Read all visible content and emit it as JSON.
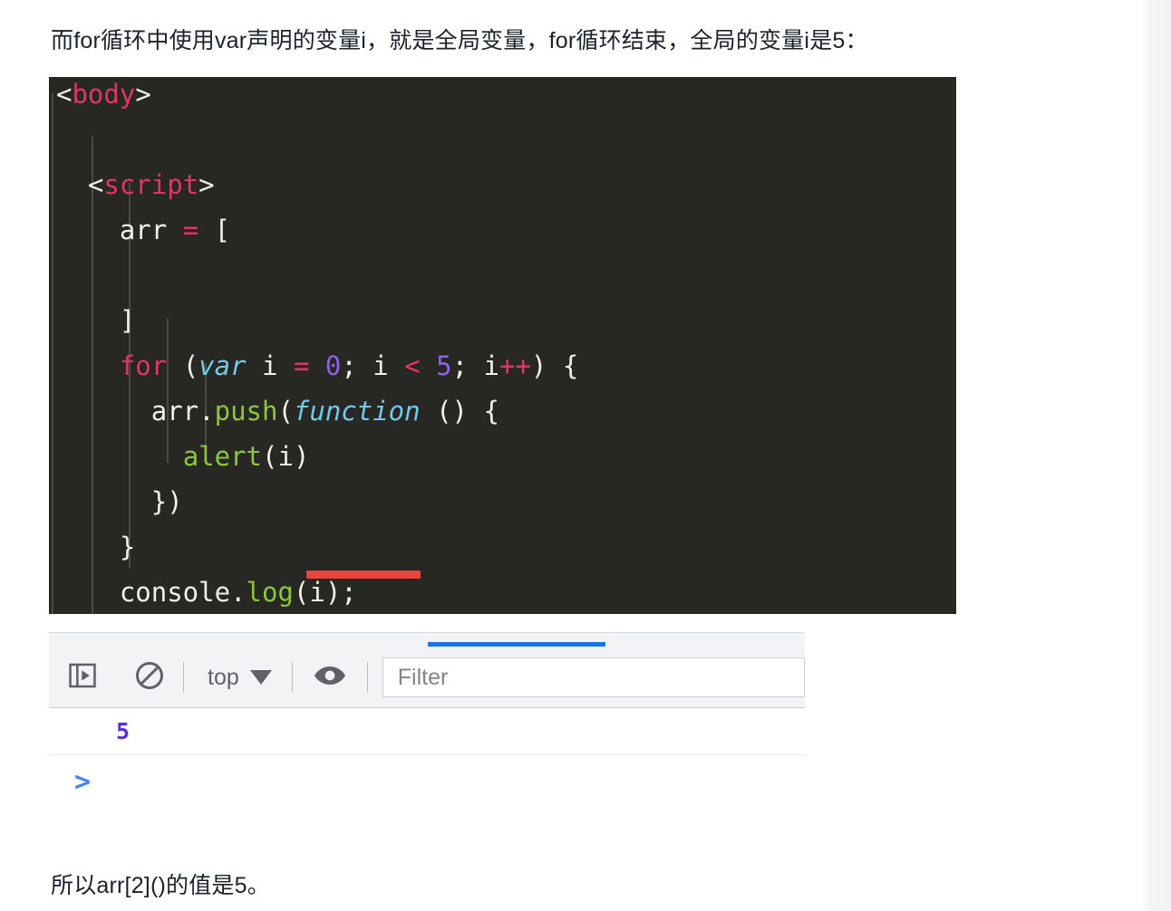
{
  "page": {
    "intro_text": "而for循环中使用var声明的变量i，就是全局变量，for循环结束，全局的变量i是5：",
    "outro_text": "所以arr[2]()的值是5。"
  },
  "code_block": {
    "background": "#272723",
    "language": "html",
    "lines": [
      {
        "indent": 0,
        "tokens": [
          {
            "t": "<",
            "c": "punct"
          },
          {
            "t": "body",
            "c": "tag"
          },
          {
            "t": ">",
            "c": "punct"
          }
        ]
      },
      {
        "indent": 0,
        "tokens": []
      },
      {
        "indent": 0,
        "tokens": [
          {
            "t": "  <",
            "c": "punct"
          },
          {
            "t": "script",
            "c": "tag"
          },
          {
            "t": ">",
            "c": "punct"
          }
        ]
      },
      {
        "indent": 0,
        "tokens": [
          {
            "t": "    arr ",
            "c": "plain"
          },
          {
            "t": "=",
            "c": "op"
          },
          {
            "t": " [",
            "c": "punct"
          }
        ]
      },
      {
        "indent": 0,
        "tokens": []
      },
      {
        "indent": 0,
        "tokens": [
          {
            "t": "    ]",
            "c": "punct"
          }
        ]
      },
      {
        "indent": 0,
        "tokens": [
          {
            "t": "    ",
            "c": "plain"
          },
          {
            "t": "for",
            "c": "keyword"
          },
          {
            "t": " (",
            "c": "punct"
          },
          {
            "t": "var",
            "c": "italic"
          },
          {
            "t": " i ",
            "c": "plain"
          },
          {
            "t": "=",
            "c": "op"
          },
          {
            "t": " ",
            "c": "plain"
          },
          {
            "t": "0",
            "c": "num"
          },
          {
            "t": "; i ",
            "c": "plain"
          },
          {
            "t": "<",
            "c": "op"
          },
          {
            "t": " ",
            "c": "plain"
          },
          {
            "t": "5",
            "c": "num"
          },
          {
            "t": "; i",
            "c": "plain"
          },
          {
            "t": "++",
            "c": "op"
          },
          {
            "t": ") {",
            "c": "punct"
          }
        ]
      },
      {
        "indent": 0,
        "tokens": [
          {
            "t": "      arr.",
            "c": "plain"
          },
          {
            "t": "push",
            "c": "method"
          },
          {
            "t": "(",
            "c": "punct"
          },
          {
            "t": "function",
            "c": "italic"
          },
          {
            "t": " () {",
            "c": "punct"
          }
        ]
      },
      {
        "indent": 0,
        "tokens": [
          {
            "t": "        ",
            "c": "plain"
          },
          {
            "t": "alert",
            "c": "func"
          },
          {
            "t": "(",
            "c": "punct"
          },
          {
            "t": "i",
            "c": "plain"
          },
          {
            "t": ")",
            "c": "punct"
          }
        ]
      },
      {
        "indent": 0,
        "tokens": [
          {
            "t": "      })",
            "c": "punct"
          }
        ]
      },
      {
        "indent": 0,
        "tokens": [
          {
            "t": "    }",
            "c": "punct"
          }
        ]
      },
      {
        "indent": 0,
        "tokens": [
          {
            "t": "    console.",
            "c": "plain"
          },
          {
            "t": "log",
            "c": "method"
          },
          {
            "t": "(",
            "c": "punct"
          },
          {
            "t": "i",
            "c": "plain"
          },
          {
            "t": ");",
            "c": "punct"
          }
        ]
      }
    ],
    "error_underline": {
      "label": "red-error-underline"
    }
  },
  "devtools": {
    "panel_name": "console-panel",
    "toolbar": {
      "sidebar_toggle_icon": "sidebar-toggle-icon",
      "clear_console_icon": "clear-console-icon",
      "context_selector_label": "top",
      "context_caret_icon": "chevron-down-icon",
      "live_expression_icon": "eye-icon",
      "filter_placeholder": "Filter",
      "filter_value": ""
    },
    "messages": [
      {
        "value": "5",
        "type": "number"
      }
    ],
    "prompt_symbol": ">",
    "accent_color": "#1a73e8"
  }
}
